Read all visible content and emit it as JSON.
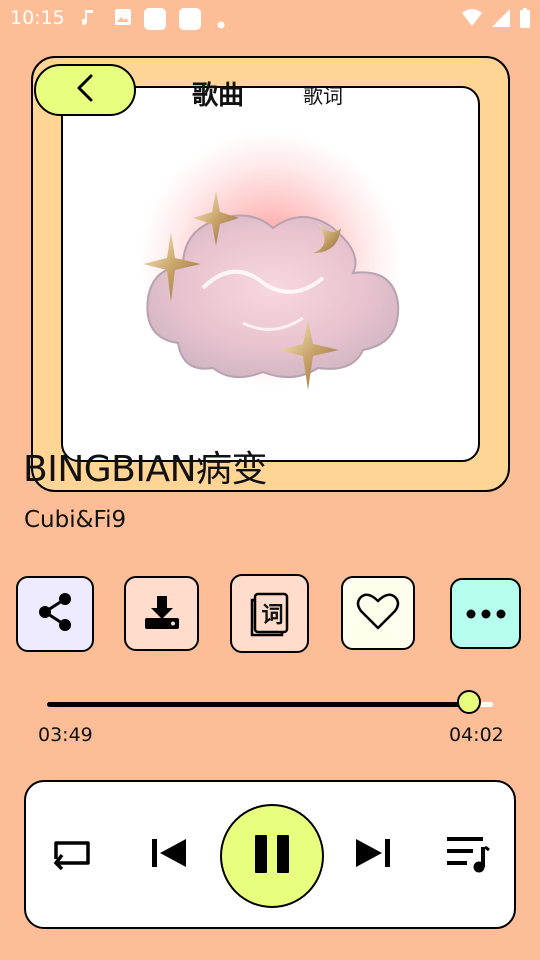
{
  "status_bar": {
    "time": "10:15",
    "icons": [
      "music-note-icon",
      "image-icon",
      "app-square-icon",
      "app-square-icon",
      "dot-icon",
      "wifi-icon",
      "signal-icon",
      "battery-icon"
    ]
  },
  "tabs": {
    "song": "歌曲",
    "lyrics": "歌词"
  },
  "track": {
    "title": "BINGBIAN病变",
    "artist": "Cubi&Fi9"
  },
  "actions": [
    {
      "name": "share",
      "icon": "share-icon",
      "color": "#EEEAFF"
    },
    {
      "name": "download",
      "icon": "download-icon",
      "color": "#FFDCCB"
    },
    {
      "name": "lyrics",
      "icon": "lyrics-icon",
      "glyph": "词",
      "color": "#FFDCCB"
    },
    {
      "name": "favorite",
      "icon": "heart-icon",
      "color": "#FFFFEE"
    },
    {
      "name": "more",
      "icon": "more-icon",
      "color": "#B6FFEE"
    }
  ],
  "progress": {
    "current": "03:49",
    "total": "04:02",
    "fraction": 0.946
  },
  "colors": {
    "background": "#FDBE97",
    "card": "#FFD595",
    "accent": "#E7FE7F"
  },
  "controls": [
    "repeat-icon",
    "previous-icon",
    "pause-icon",
    "next-icon",
    "playlist-icon"
  ]
}
